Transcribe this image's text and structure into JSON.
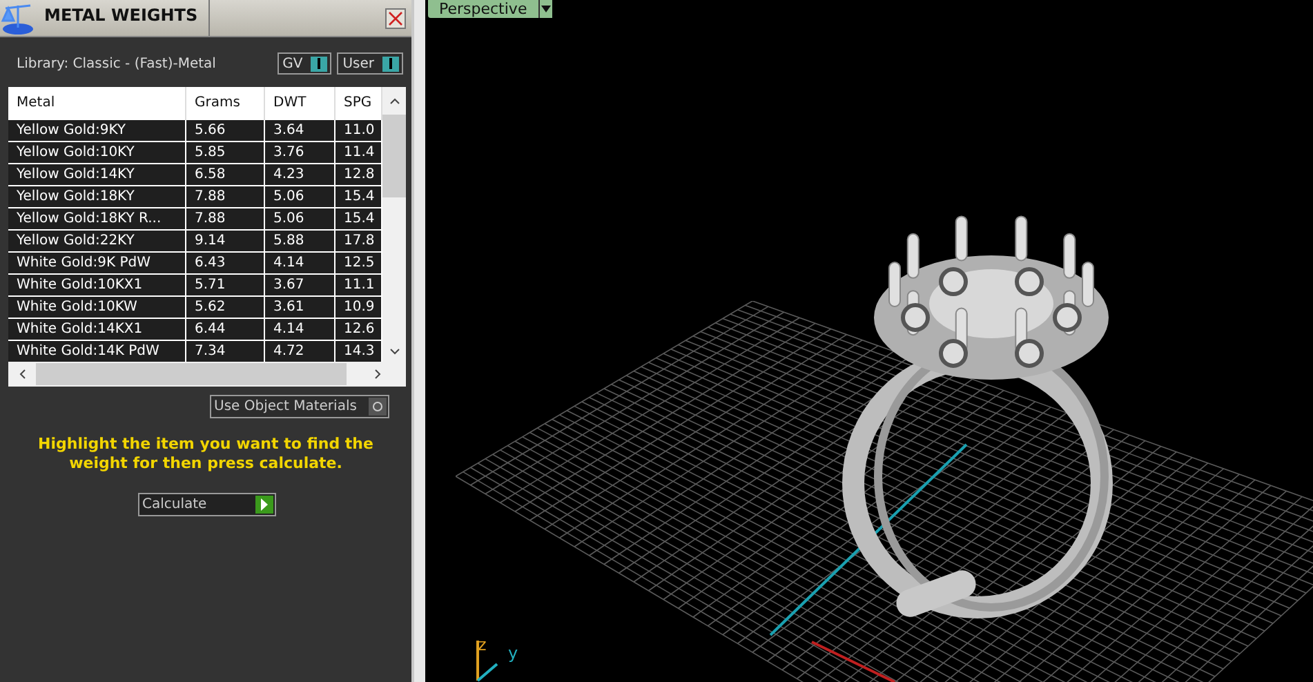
{
  "panel": {
    "title": "METAL WEIGHTS",
    "library": "Library: Classic - (Fast)-Metal",
    "toggles": [
      {
        "label": "GV",
        "on": true
      },
      {
        "label": "User",
        "on": true
      }
    ],
    "table": {
      "columns": [
        "Metal",
        "Grams",
        "DWT",
        "SPG"
      ],
      "rows": [
        {
          "cells": [
            "Yellow Gold:9KY",
            "5.66",
            "3.64",
            "11.0"
          ]
        },
        {
          "cells": [
            "Yellow Gold:10KY",
            "5.85",
            "3.76",
            "11.4"
          ]
        },
        {
          "cells": [
            "Yellow Gold:14KY",
            "6.58",
            "4.23",
            "12.8"
          ]
        },
        {
          "cells": [
            "Yellow Gold:18KY",
            "7.88",
            "5.06",
            "15.4"
          ]
        },
        {
          "cells": [
            "Yellow Gold:18KY R...",
            "7.88",
            "5.06",
            "15.4"
          ]
        },
        {
          "cells": [
            "Yellow Gold:22KY",
            "9.14",
            "5.88",
            "17.8"
          ]
        },
        {
          "cells": [
            "White Gold:9K PdW",
            "6.43",
            "4.14",
            "12.5"
          ]
        },
        {
          "cells": [
            "White Gold:10KX1",
            "5.71",
            "3.67",
            "11.1"
          ]
        },
        {
          "cells": [
            "White Gold:10KW",
            "5.62",
            "3.61",
            "10.9"
          ]
        },
        {
          "cells": [
            "White Gold:14KX1",
            "6.44",
            "4.14",
            "12.6"
          ]
        },
        {
          "cells": [
            "White Gold:14K PdW",
            "7.34",
            "4.72",
            "14.3"
          ]
        }
      ]
    },
    "object_materials": {
      "label": "Use Object Materials",
      "on": false
    },
    "instruction": "Highlight the item you want to find the weight for then press calculate.",
    "calculate": "Calculate"
  },
  "viewport": {
    "view": "Perspective",
    "axes": [
      "z",
      "y"
    ]
  }
}
